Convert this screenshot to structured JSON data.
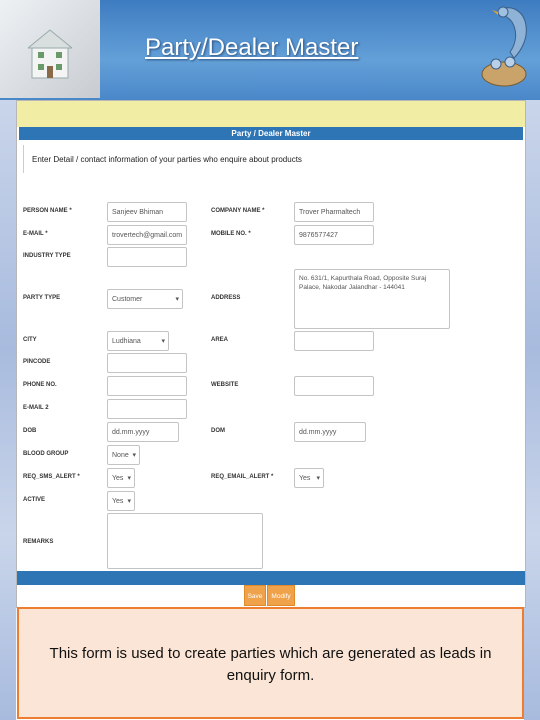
{
  "slide": {
    "title": "Party/Dealer Master",
    "description": "This form is used to create parties which are generated as leads in enquiry form."
  },
  "form": {
    "title": "Party / Dealer Master",
    "intro": "Enter Detail / contact information of your parties who enquire about products",
    "fields": {
      "person_name": {
        "label": "PERSON NAME *",
        "value": "Sanjeev Bhiman"
      },
      "company_name": {
        "label": "COMPANY NAME *",
        "value": "Trover Pharmaltech"
      },
      "email": {
        "label": "E-MAIL *",
        "value": "trovertech@gmail.com"
      },
      "mobile": {
        "label": "MOBILE NO. *",
        "value": "9876577427"
      },
      "industry_type": {
        "label": "INDUSTRY TYPE",
        "value": ""
      },
      "party_type": {
        "label": "PARTY TYPE",
        "value": "Customer"
      },
      "address": {
        "label": "ADDRESS",
        "value": "No. 631/1, Kapurthala Road, Opposite Suraj Palace, Nakodar Jalandhar - 144041"
      },
      "city": {
        "label": "CITY",
        "value": "Ludhiana"
      },
      "area": {
        "label": "AREA",
        "value": ""
      },
      "pincode": {
        "label": "PINCODE",
        "value": ""
      },
      "phone": {
        "label": "PHONE NO.",
        "value": ""
      },
      "website": {
        "label": "WEBSITE",
        "value": ""
      },
      "email2": {
        "label": "E-MAIL 2",
        "value": ""
      },
      "dob": {
        "label": "DOB",
        "value": "dd.mm.yyyy"
      },
      "dom": {
        "label": "DOM",
        "value": "dd.mm.yyyy"
      },
      "blood_group": {
        "label": "BLOOD GROUP",
        "value": "None"
      },
      "sms_alert": {
        "label": "REQ_SMS_ALERT *",
        "value": "Yes"
      },
      "email_alert": {
        "label": "REQ_EMAIL_ALERT *",
        "value": "Yes"
      },
      "active": {
        "label": "ACTIVE",
        "value": "Yes"
      },
      "remarks": {
        "label": "REMARKS",
        "value": ""
      }
    },
    "buttons": {
      "save": "Save",
      "modify": "Modify"
    }
  },
  "colors": {
    "header_blue": "#4f86c6",
    "form_bar": "#2e75b6",
    "button_orange": "#f0a24a",
    "desc_border": "#ed7d31",
    "desc_fill": "#fbe5d6"
  }
}
